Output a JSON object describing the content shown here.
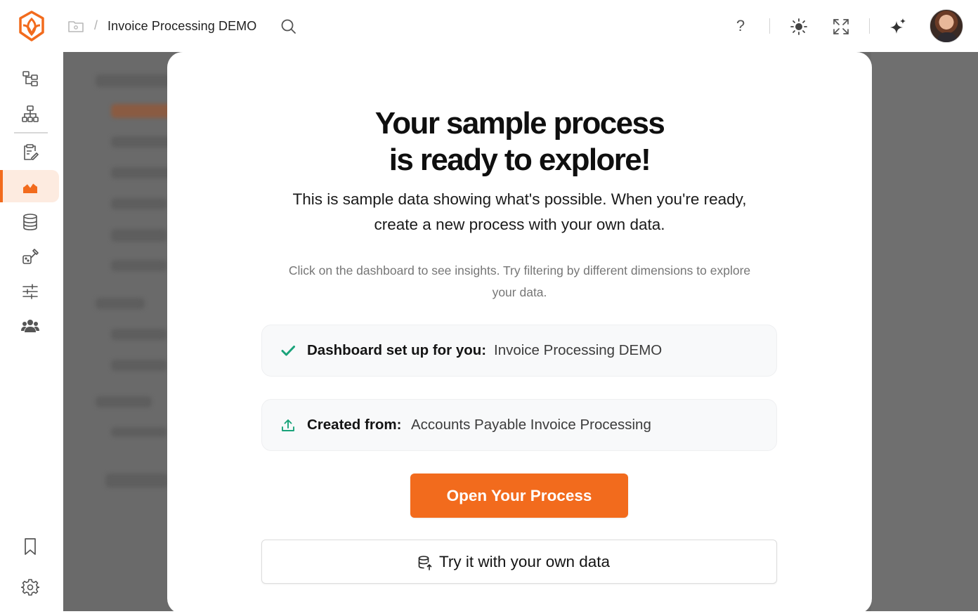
{
  "header": {
    "breadcrumb_separator": "/",
    "process_title": "Invoice Processing DEMO",
    "help_label": "?"
  },
  "sidebar": {
    "items": [
      {
        "name": "hierarchy-icon"
      },
      {
        "name": "org-chart-icon"
      },
      {
        "name": "clipboard-edit-icon"
      },
      {
        "name": "dashboard-icon",
        "active": true
      },
      {
        "name": "database-icon"
      },
      {
        "name": "integrations-icon"
      },
      {
        "name": "sliders-icon"
      },
      {
        "name": "users-icon"
      },
      {
        "name": "bookmark-icon"
      },
      {
        "name": "settings-icon"
      }
    ]
  },
  "modal": {
    "title_line1": "Your sample process",
    "title_line2": "is ready to explore!",
    "subtitle_line1": "This is sample data showing what's possible. When you're ready,",
    "subtitle_line2": "create a new process with your own data.",
    "hint_line1": "Click on the dashboard to see insights. Try filtering by different dimensions to explore",
    "hint_line2": "your data.",
    "dashboard_card": {
      "label": "Dashboard set up for you:",
      "value": "Invoice Processing DEMO"
    },
    "source_card": {
      "label": "Created from:",
      "value": "Accounts Payable Invoice Processing"
    },
    "primary_button": "Open Your Process",
    "secondary_button": "Try it with your own data"
  },
  "colors": {
    "accent": "#f26b1d",
    "accent_soft": "#fdebe0",
    "success": "#1aa37a",
    "backdrop": "#6a6a6a"
  }
}
